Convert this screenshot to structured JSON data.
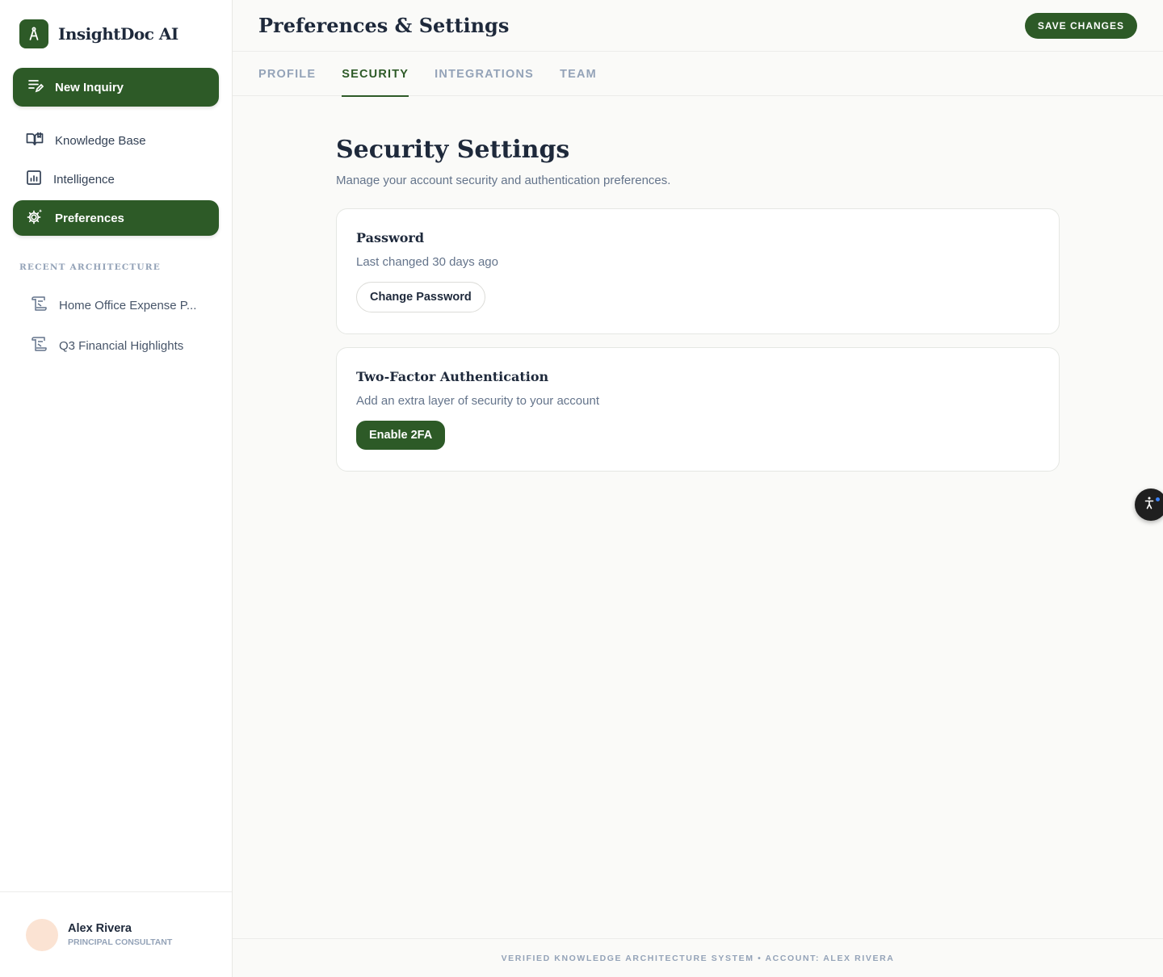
{
  "brand": {
    "name": "InsightDoc AI"
  },
  "sidebar": {
    "new_inquiry": "New Inquiry",
    "nav": [
      {
        "label": "Knowledge Base",
        "icon": "book-icon"
      },
      {
        "label": "Intelligence",
        "icon": "bar-chart-icon"
      },
      {
        "label": "Preferences",
        "icon": "gear-icon",
        "active": true
      }
    ],
    "recent_title": "RECENT ARCHITECTURE",
    "recent": [
      {
        "label": "Home Office Expense P...",
        "icon": "document-icon"
      },
      {
        "label": "Q3 Financial Highlights",
        "icon": "document-icon"
      }
    ],
    "user": {
      "name": "Alex Rivera",
      "role": "PRINCIPAL CONSULTANT"
    }
  },
  "header": {
    "title": "Preferences & Settings",
    "save_label": "SAVE CHANGES"
  },
  "tabs": [
    {
      "label": "PROFILE"
    },
    {
      "label": "SECURITY",
      "active": true
    },
    {
      "label": "INTEGRATIONS"
    },
    {
      "label": "TEAM"
    }
  ],
  "security": {
    "title": "Security Settings",
    "subtitle": "Manage your account security and authentication preferences.",
    "password": {
      "title": "Password",
      "desc": "Last changed 30 days ago",
      "button": "Change Password"
    },
    "twofa": {
      "title": "Two-Factor Authentication",
      "desc": "Add an extra layer of security to your account",
      "button": "Enable 2FA"
    }
  },
  "footer": {
    "text": "VERIFIED KNOWLEDGE ARCHITECTURE SYSTEM • ACCOUNT: ALEX RIVERA"
  },
  "colors": {
    "accent": "#2d5a27",
    "muted": "#94a3b8",
    "background": "#fafaf8"
  }
}
